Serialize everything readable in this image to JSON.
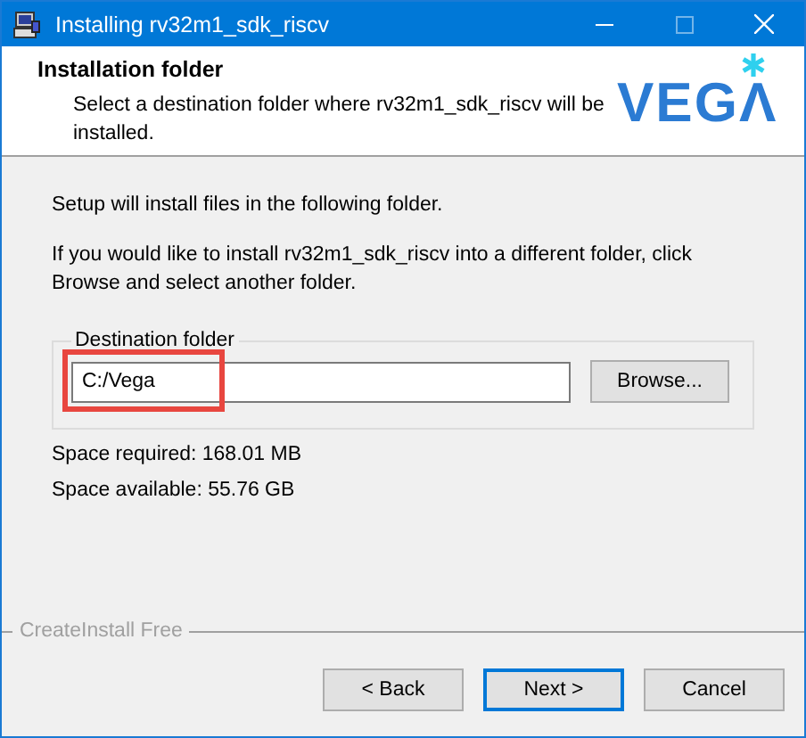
{
  "window": {
    "title": "Installing rv32m1_sdk_riscv"
  },
  "header": {
    "title": "Installation folder",
    "subtitle": "Select a destination folder where rv32m1_sdk_riscv will be installed.",
    "logo": "VEGΛ"
  },
  "body": {
    "paragraphs": [
      "Setup will install files in the following folder.",
      "If you would like to install rv32m1_sdk_riscv into a different folder, click Browse and select another folder."
    ]
  },
  "destination": {
    "legend": "Destination folder",
    "value": "C:/Vega",
    "highlighted": true,
    "browse_button": "Browse..."
  },
  "space": [
    "Space required: 168.01 MB",
    "Space available: 55.76 GB"
  ],
  "footer": {
    "brand": "CreateInstall Free"
  },
  "buttons": [
    {
      "label": "< Back",
      "focused": false
    },
    {
      "label": "Next >",
      "focused": true
    },
    {
      "label": "Cancel",
      "focused": false
    }
  ]
}
